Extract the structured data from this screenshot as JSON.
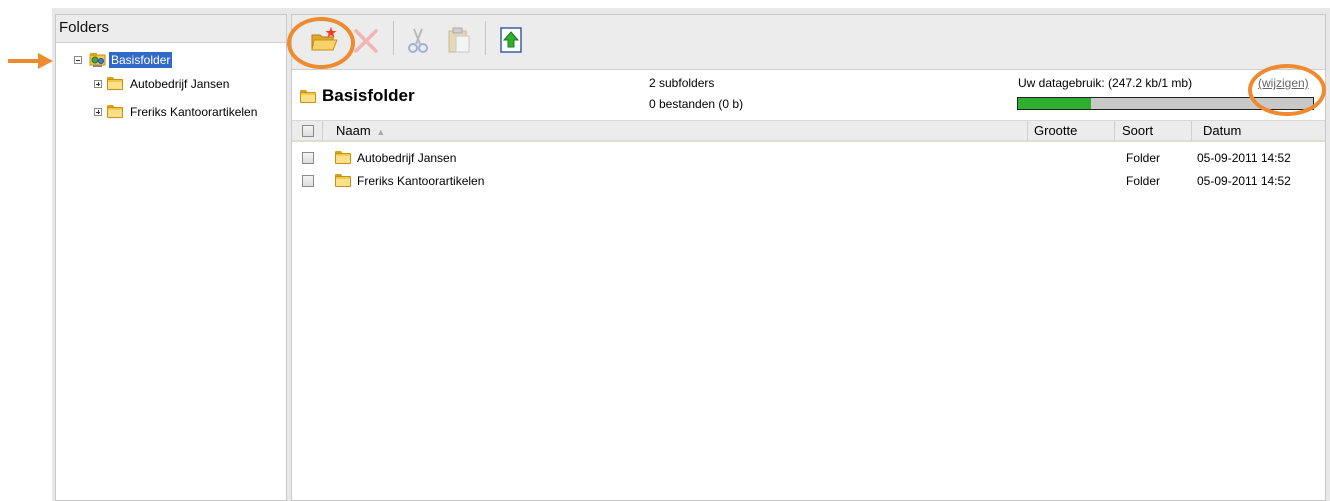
{
  "left_panel": {
    "title": "Folders",
    "tree": {
      "root": {
        "label": "Basisfolder",
        "selected": true,
        "icon": "network-folder-icon"
      },
      "children": [
        {
          "label": "Autobedrijf Jansen",
          "icon": "folder-icon"
        },
        {
          "label": "Freriks Kantoorartikelen",
          "icon": "folder-icon"
        }
      ]
    }
  },
  "toolbar": {
    "buttons": [
      {
        "name": "new-folder",
        "icon": "new-folder-icon",
        "enabled": true
      },
      {
        "name": "delete",
        "icon": "delete-x-icon",
        "enabled": false
      },
      {
        "name": "cut",
        "icon": "scissors-icon",
        "enabled": false
      },
      {
        "name": "paste",
        "icon": "clipboard-icon",
        "enabled": false
      },
      {
        "name": "upload",
        "icon": "upload-arrow-icon",
        "enabled": true
      }
    ]
  },
  "folder_info": {
    "title": "Basisfolder",
    "subfolders": "2 subfolders",
    "files": "0 bestanden (0 b)"
  },
  "usage": {
    "label": "Uw datagebruik: (247.2 kb/1 mb)",
    "change_link": "(wijzigen)",
    "fraction": 0.247
  },
  "grid": {
    "columns": {
      "name": "Naam",
      "size": "Grootte",
      "type": "Soort",
      "date": "Datum"
    },
    "sort_indicator": "▲",
    "rows": [
      {
        "name": "Autobedrijf Jansen",
        "size": "",
        "type": "Folder",
        "date": "05-09-2011 14:52"
      },
      {
        "name": "Freriks Kantoorartikelen",
        "size": "",
        "type": "Folder",
        "date": "05-09-2011 14:52"
      }
    ]
  },
  "colors": {
    "accent_orange": "#f08a2e",
    "progress_green": "#2fae2f",
    "selection_blue": "#3269c8"
  }
}
